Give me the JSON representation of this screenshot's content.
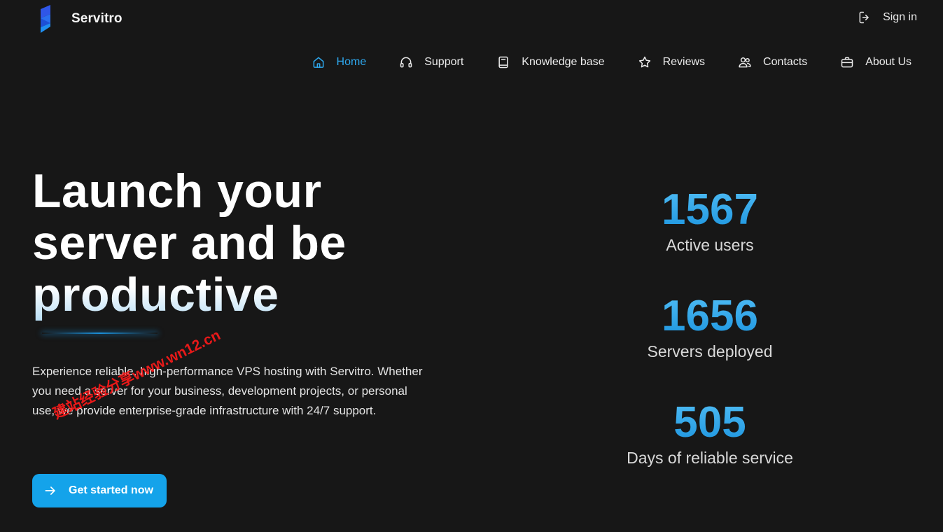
{
  "brand": {
    "name": "Servitro",
    "logo_icon": "servitro-logo-icon",
    "logo_colors": [
      "#2f56e8",
      "#1f8ef0"
    ]
  },
  "header": {
    "sign_in_label": "Sign in",
    "sign_in_icon": "sign-in-icon"
  },
  "nav": {
    "items": [
      {
        "label": "Home",
        "icon": "home-icon",
        "active": true
      },
      {
        "label": "Support",
        "icon": "headphones-icon",
        "active": false
      },
      {
        "label": "Knowledge base",
        "icon": "book-icon",
        "active": false
      },
      {
        "label": "Reviews",
        "icon": "star-icon",
        "active": false
      },
      {
        "label": "Contacts",
        "icon": "users-icon",
        "active": false
      },
      {
        "label": "About Us",
        "icon": "briefcase-icon",
        "active": false
      }
    ]
  },
  "hero": {
    "title_lines": [
      "Launch your",
      "server and be",
      "productive"
    ],
    "description": "Experience reliable, high-performance VPS hosting with Servitro. Whether you need a server for your business, development projects, or personal use, we provide enterprise-grade infrastructure with 24/7 support.",
    "cta_label": "Get started now",
    "cta_icon": "arrow-right-icon"
  },
  "stats": [
    {
      "value": "1567",
      "label": "Active users"
    },
    {
      "value": "1656",
      "label": "Servers deployed"
    },
    {
      "value": "505",
      "label": "Days of reliable service"
    }
  ],
  "watermark": {
    "text": "建站经验分享www.wn12.cn"
  },
  "colors": {
    "background": "#171717",
    "accent": "#2ea8ee",
    "button": "#14a3ea",
    "text": "#ffffff",
    "watermark": "#ff1a1a"
  }
}
